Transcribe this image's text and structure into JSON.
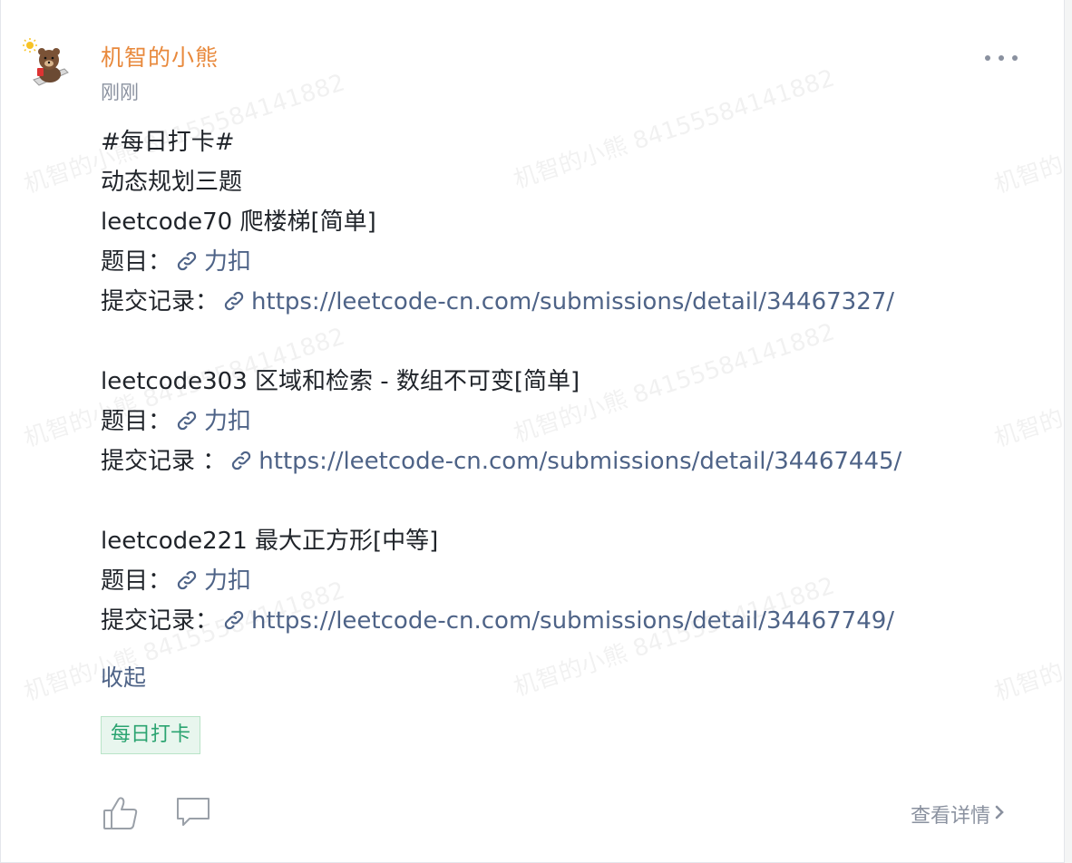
{
  "post": {
    "author": "机智的小熊",
    "time": "刚刚",
    "lines": [
      {
        "text": "#每日打卡#"
      },
      {
        "text": "动态规划三题"
      },
      {
        "text": "leetcode70 爬楼梯[简单]"
      },
      {
        "prefix": "题目：",
        "link": "力扣"
      },
      {
        "prefix": "提交记录：",
        "link": "https://leetcode-cn.com/submissions/detail/34467327/"
      },
      {
        "text": ""
      },
      {
        "text": "leetcode303  区域和检索 - 数组不可变[简单]"
      },
      {
        "prefix": "题目：",
        "link": "力扣"
      },
      {
        "prefix": "提交记录 ：",
        "link": "https://leetcode-cn.com/submissions/detail/34467445/"
      },
      {
        "text": ""
      },
      {
        "text": "leetcode221 最大正方形[中等]"
      },
      {
        "prefix": "题目：",
        "link": "力扣"
      },
      {
        "prefix": "提交记录：",
        "link": "https://leetcode-cn.com/submissions/detail/34467749/"
      }
    ],
    "collapse_label": "收起",
    "tag": "每日打卡",
    "detail_label": "查看详情",
    "watermark_text": "机智的小熊 84155584141882"
  },
  "colors": {
    "author": "#e8893c",
    "link": "#4e6387",
    "tag_text": "#2ba471",
    "tag_bg": "#e8f6ee"
  },
  "icons": {
    "more": "more-dots-icon",
    "link": "link-chain-icon",
    "like": "thumbs-up-icon",
    "comment": "comment-bubble-icon",
    "detail": "chevron-right-icon"
  }
}
